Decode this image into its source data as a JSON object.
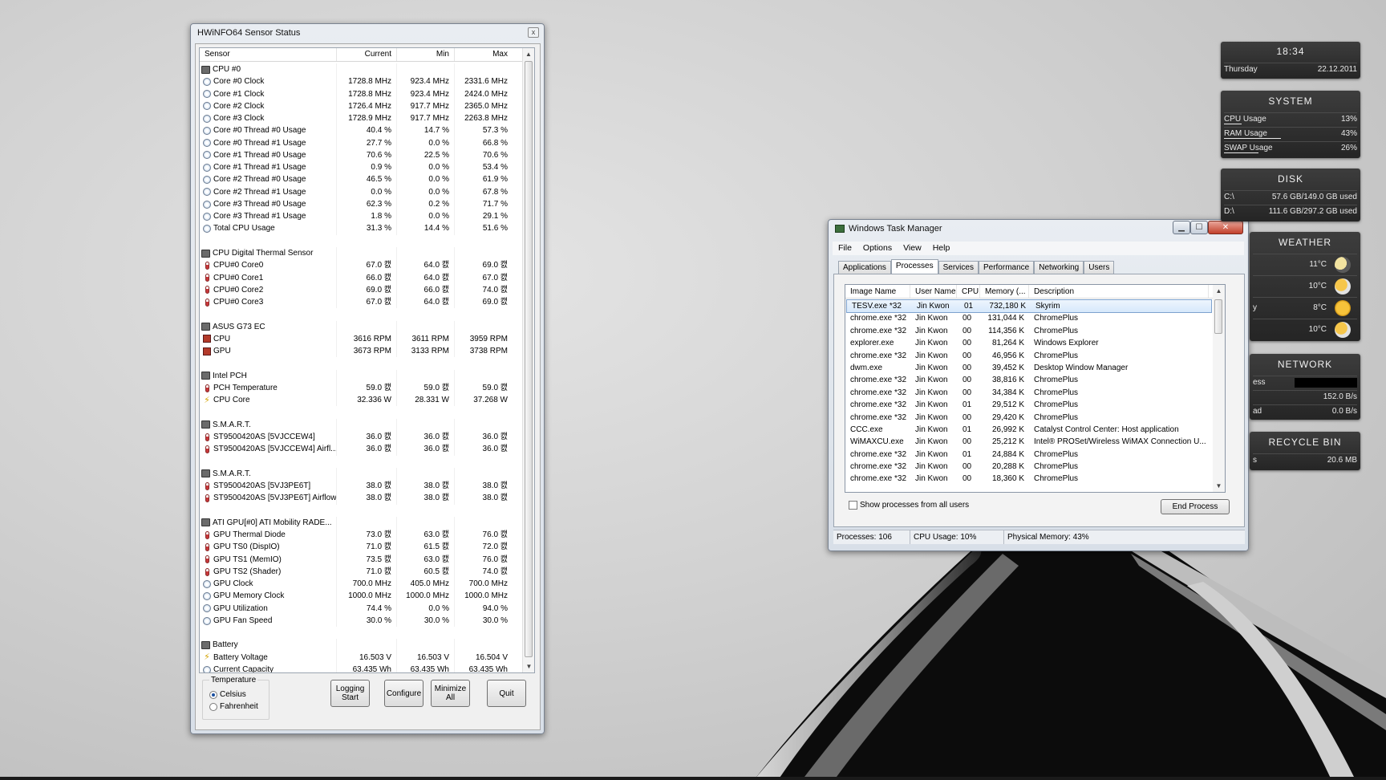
{
  "hwinfo": {
    "title": "HWiNFO64 Sensor Status",
    "close_glyph": "x",
    "columns": [
      "Sensor",
      "Current",
      "Min",
      "Max"
    ],
    "rows": [
      {
        "type": "group",
        "name": "CPU #0"
      },
      {
        "type": "clock",
        "name": "Core #0 Clock",
        "cur": "1728.8 MHz",
        "min": "923.4 MHz",
        "max": "2331.6 MHz"
      },
      {
        "type": "clock",
        "name": "Core #1 Clock",
        "cur": "1728.8 MHz",
        "min": "923.4 MHz",
        "max": "2424.0 MHz"
      },
      {
        "type": "clock",
        "name": "Core #2 Clock",
        "cur": "1726.4 MHz",
        "min": "917.7 MHz",
        "max": "2365.0 MHz"
      },
      {
        "type": "clock",
        "name": "Core #3 Clock",
        "cur": "1728.9 MHz",
        "min": "917.7 MHz",
        "max": "2263.8 MHz"
      },
      {
        "type": "clock",
        "name": "Core #0 Thread #0 Usage",
        "cur": "40.4 %",
        "min": "14.7 %",
        "max": "57.3 %"
      },
      {
        "type": "clock",
        "name": "Core #0 Thread #1 Usage",
        "cur": "27.7 %",
        "min": "0.0 %",
        "max": "66.8 %"
      },
      {
        "type": "clock",
        "name": "Core #1 Thread #0 Usage",
        "cur": "70.6 %",
        "min": "22.5 %",
        "max": "70.6 %"
      },
      {
        "type": "clock",
        "name": "Core #1 Thread #1 Usage",
        "cur": "0.9 %",
        "min": "0.0 %",
        "max": "53.4 %"
      },
      {
        "type": "clock",
        "name": "Core #2 Thread #0 Usage",
        "cur": "46.5 %",
        "min": "0.0 %",
        "max": "61.9 %"
      },
      {
        "type": "clock",
        "name": "Core #2 Thread #1 Usage",
        "cur": "0.0 %",
        "min": "0.0 %",
        "max": "67.8 %"
      },
      {
        "type": "clock",
        "name": "Core #3 Thread #0 Usage",
        "cur": "62.3 %",
        "min": "0.2 %",
        "max": "71.7 %"
      },
      {
        "type": "clock",
        "name": "Core #3 Thread #1 Usage",
        "cur": "1.8 %",
        "min": "0.0 %",
        "max": "29.1 %"
      },
      {
        "type": "clock",
        "name": "Total CPU Usage",
        "cur": "31.3 %",
        "min": "14.4 %",
        "max": "51.6 %"
      },
      {
        "type": "blank"
      },
      {
        "type": "group",
        "name": "CPU Digital Thermal Sensor"
      },
      {
        "type": "temp",
        "name": "CPU#0 Core0",
        "cur": "67.0 캜",
        "min": "64.0 캜",
        "max": "69.0 캜"
      },
      {
        "type": "temp",
        "name": "CPU#0 Core1",
        "cur": "66.0 캜",
        "min": "64.0 캜",
        "max": "67.0 캜"
      },
      {
        "type": "temp",
        "name": "CPU#0 Core2",
        "cur": "69.0 캜",
        "min": "66.0 캜",
        "max": "74.0 캜"
      },
      {
        "type": "temp",
        "name": "CPU#0 Core3",
        "cur": "67.0 캜",
        "min": "64.0 캜",
        "max": "69.0 캜"
      },
      {
        "type": "blank"
      },
      {
        "type": "group",
        "name": "ASUS G73 EC"
      },
      {
        "type": "fan",
        "name": "CPU",
        "cur": "3616 RPM",
        "min": "3611 RPM",
        "max": "3959 RPM"
      },
      {
        "type": "fan",
        "name": "GPU",
        "cur": "3673 RPM",
        "min": "3133 RPM",
        "max": "3738 RPM"
      },
      {
        "type": "blank"
      },
      {
        "type": "group",
        "name": "Intel PCH"
      },
      {
        "type": "temp",
        "name": "PCH Temperature",
        "cur": "59.0 캜",
        "min": "59.0 캜",
        "max": "59.0 캜"
      },
      {
        "type": "volt",
        "name": "CPU Core",
        "cur": "32.336 W",
        "min": "28.331 W",
        "max": "37.268 W"
      },
      {
        "type": "blank"
      },
      {
        "type": "group",
        "name": "S.M.A.R.T."
      },
      {
        "type": "temp",
        "name": "ST9500420AS [5VJCCEW4]",
        "cur": "36.0 캜",
        "min": "36.0 캜",
        "max": "36.0 캜"
      },
      {
        "type": "temp",
        "name": "ST9500420AS [5VJCCEW4] Airfl...",
        "cur": "36.0 캜",
        "min": "36.0 캜",
        "max": "36.0 캜"
      },
      {
        "type": "blank"
      },
      {
        "type": "group",
        "name": "S.M.A.R.T."
      },
      {
        "type": "temp",
        "name": "ST9500420AS [5VJ3PE6T]",
        "cur": "38.0 캜",
        "min": "38.0 캜",
        "max": "38.0 캜"
      },
      {
        "type": "temp",
        "name": "ST9500420AS [5VJ3PE6T] Airflow",
        "cur": "38.0 캜",
        "min": "38.0 캜",
        "max": "38.0 캜"
      },
      {
        "type": "blank"
      },
      {
        "type": "group",
        "name": "ATI GPU[#0] ATI Mobility RADE..."
      },
      {
        "type": "temp",
        "name": "GPU Thermal Diode",
        "cur": "73.0 캜",
        "min": "63.0 캜",
        "max": "76.0 캜"
      },
      {
        "type": "temp",
        "name": "GPU TS0 (DispIO)",
        "cur": "71.0 캜",
        "min": "61.5 캜",
        "max": "72.0 캜"
      },
      {
        "type": "temp",
        "name": "GPU TS1 (MemIO)",
        "cur": "73.5 캜",
        "min": "63.0 캜",
        "max": "76.0 캜"
      },
      {
        "type": "temp",
        "name": "GPU TS2 (Shader)",
        "cur": "71.0 캜",
        "min": "60.5 캜",
        "max": "74.0 캜"
      },
      {
        "type": "clock",
        "name": "GPU Clock",
        "cur": "700.0 MHz",
        "min": "405.0 MHz",
        "max": "700.0 MHz"
      },
      {
        "type": "clock",
        "name": "GPU Memory Clock",
        "cur": "1000.0 MHz",
        "min": "1000.0 MHz",
        "max": "1000.0 MHz"
      },
      {
        "type": "clock",
        "name": "GPU Utilization",
        "cur": "74.4 %",
        "min": "0.0 %",
        "max": "94.0 %"
      },
      {
        "type": "clock",
        "name": "GPU Fan Speed",
        "cur": "30.0 %",
        "min": "30.0 %",
        "max": "30.0 %"
      },
      {
        "type": "blank"
      },
      {
        "type": "group",
        "name": "Battery"
      },
      {
        "type": "volt",
        "name": "Battery Voltage",
        "cur": "16.503 V",
        "min": "16.503 V",
        "max": "16.504 V"
      },
      {
        "type": "clock",
        "name": "Current Capacity",
        "cur": "63.435 Wh",
        "min": "63.435 Wh",
        "max": "63.435 Wh"
      }
    ],
    "temperature_label": "Temperature",
    "celsius_label": "Celsius",
    "fahrenheit_label": "Fahrenheit",
    "selected_unit": "Celsius",
    "logging_button": "Logging Start",
    "configure_button": "Configure",
    "minimize_button": "Minimize All",
    "quit_button": "Quit"
  },
  "taskmanager": {
    "title": "Windows Task Manager",
    "menu": [
      "File",
      "Options",
      "View",
      "Help"
    ],
    "tabs": [
      "Applications",
      "Processes",
      "Services",
      "Performance",
      "Networking",
      "Users"
    ],
    "active_tab": "Processes",
    "columns": [
      "Image Name",
      "User Name",
      "CPU",
      "Memory (...",
      "Description"
    ],
    "processes": [
      {
        "image": "TESV.exe *32",
        "user": "Jin Kwon",
        "cpu": "01",
        "mem": "732,180 K",
        "desc": "Skyrim",
        "selected": true
      },
      {
        "image": "chrome.exe *32",
        "user": "Jin Kwon",
        "cpu": "00",
        "mem": "131,044 K",
        "desc": "ChromePlus"
      },
      {
        "image": "chrome.exe *32",
        "user": "Jin Kwon",
        "cpu": "00",
        "mem": "114,356 K",
        "desc": "ChromePlus"
      },
      {
        "image": "explorer.exe",
        "user": "Jin Kwon",
        "cpu": "00",
        "mem": "81,264 K",
        "desc": "Windows Explorer"
      },
      {
        "image": "chrome.exe *32",
        "user": "Jin Kwon",
        "cpu": "00",
        "mem": "46,956 K",
        "desc": "ChromePlus"
      },
      {
        "image": "dwm.exe",
        "user": "Jin Kwon",
        "cpu": "00",
        "mem": "39,452 K",
        "desc": "Desktop Window Manager"
      },
      {
        "image": "chrome.exe *32",
        "user": "Jin Kwon",
        "cpu": "00",
        "mem": "38,816 K",
        "desc": "ChromePlus"
      },
      {
        "image": "chrome.exe *32",
        "user": "Jin Kwon",
        "cpu": "00",
        "mem": "34,384 K",
        "desc": "ChromePlus"
      },
      {
        "image": "chrome.exe *32",
        "user": "Jin Kwon",
        "cpu": "01",
        "mem": "29,512 K",
        "desc": "ChromePlus"
      },
      {
        "image": "chrome.exe *32",
        "user": "Jin Kwon",
        "cpu": "00",
        "mem": "29,420 K",
        "desc": "ChromePlus"
      },
      {
        "image": "CCC.exe",
        "user": "Jin Kwon",
        "cpu": "01",
        "mem": "26,992 K",
        "desc": "Catalyst Control Center: Host application"
      },
      {
        "image": "WiMAXCU.exe",
        "user": "Jin Kwon",
        "cpu": "00",
        "mem": "25,212 K",
        "desc": "Intel® PROSet/Wireless WiMAX Connection U..."
      },
      {
        "image": "chrome.exe *32",
        "user": "Jin Kwon",
        "cpu": "01",
        "mem": "24,884 K",
        "desc": "ChromePlus"
      },
      {
        "image": "chrome.exe *32",
        "user": "Jin Kwon",
        "cpu": "00",
        "mem": "20,288 K",
        "desc": "ChromePlus"
      },
      {
        "image": "chrome.exe *32",
        "user": "Jin Kwon",
        "cpu": "00",
        "mem": "18,360 K",
        "desc": "ChromePlus"
      }
    ],
    "show_all_label": "Show processes from all users",
    "end_process_label": "End Process",
    "status": {
      "processes": "Processes: 106",
      "cpu": "CPU Usage: 10%",
      "memory": "Physical Memory: 43%"
    }
  },
  "widgets": {
    "clock": {
      "time": "18:34",
      "day": "Thursday",
      "date": "22.12.2011"
    },
    "system": {
      "title": "SYSTEM",
      "rows": [
        {
          "label": "CPU Usage",
          "value": "13%",
          "level": 0.13
        },
        {
          "label": "RAM Usage",
          "value": "43%",
          "level": 0.43
        },
        {
          "label": "SWAP Usage",
          "value": "26%",
          "level": 0.26
        }
      ]
    },
    "disk": {
      "title": "DISK",
      "rows": [
        {
          "label": "C:\\",
          "value": "57.6 GB/149.0 GB used"
        },
        {
          "label": "D:\\",
          "value": "111.6 GB/297.2 GB used"
        }
      ]
    },
    "weather": {
      "title": "WEATHER",
      "rows": [
        {
          "label": "",
          "value": "11°C",
          "icon": "moon-icon"
        },
        {
          "label": "",
          "value": "10°C",
          "icon": "sun-cloud-icon"
        },
        {
          "label": "y",
          "value": "8°C",
          "icon": "sun-icon"
        },
        {
          "label": "",
          "value": "10°C",
          "icon": "sun-cloud-icon"
        }
      ]
    },
    "network": {
      "title": "NETWORK",
      "rows": [
        {
          "label": "ess",
          "value": ""
        },
        {
          "label": "",
          "value": "152.0 B/s"
        },
        {
          "label": "ad",
          "value": "0.0 B/s"
        }
      ]
    },
    "recycle": {
      "title": "RECYCLE BIN",
      "label": "s",
      "value": "20.6 MB"
    }
  },
  "colors": {
    "accent": "#3a6ea5",
    "widget_bg": "#2e2e2e",
    "close_red": "#c2402b"
  }
}
